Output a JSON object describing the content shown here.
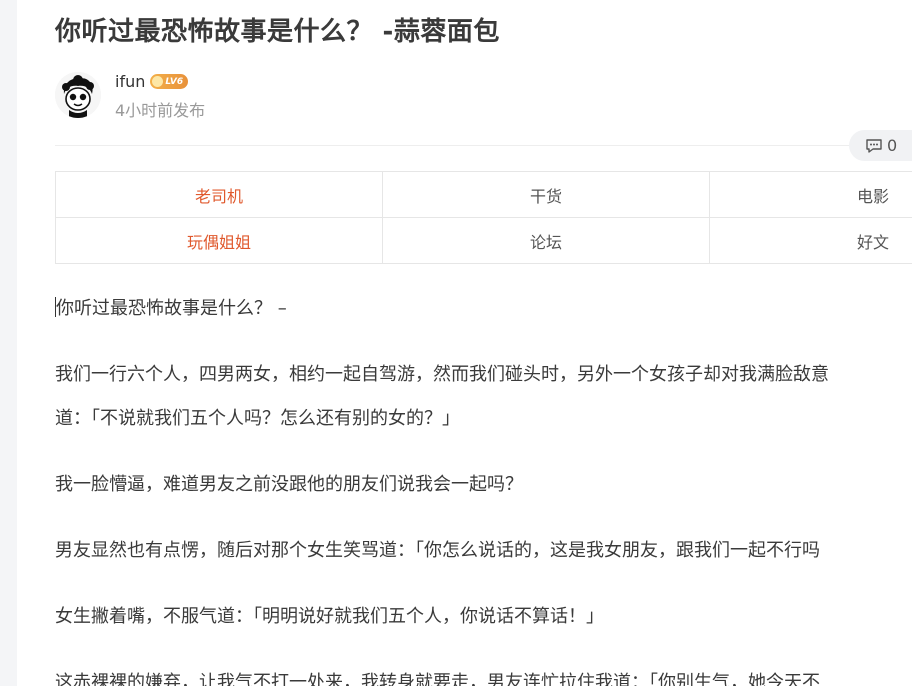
{
  "post": {
    "title": "你听过最恐怖故事是什么？ -蒜蓉面包",
    "author": {
      "name": "ifun",
      "level": "LV6",
      "time": "4小时前发布"
    },
    "comment_count": "0"
  },
  "tags": {
    "row1": [
      "老司机",
      "干货",
      "电影"
    ],
    "row2": [
      "玩偶姐姐",
      "论坛",
      "好文"
    ]
  },
  "article": {
    "p1": "你听过最恐怖故事是什么？ –",
    "p2_line1": "我们一行六个人，四男两女，相约一起自驾游，然而我们碰头时，另外一个女孩子却对我满脸敌意",
    "p2_line2": "道：「不说就我们五个人吗？怎么还有别的女的？」",
    "p3": "我一脸懵逼，难道男友之前没跟他的朋友们说我会一起吗？",
    "p4": "男友显然也有点愣，随后对那个女生笑骂道：「你怎么说话的，这是我女朋友，跟我们一起不行吗",
    "p5": "女生撇着嘴，不服气道：「明明说好就我们五个人，你说话不算话！」",
    "p6": "这赤裸裸的嫌弃，让我气不打一处来，我转身就要走，男友连忙拉住我道：「你别生气，她今天不"
  },
  "colors": {
    "accent_tag": "#e0592d",
    "badge": "#e8913a"
  }
}
